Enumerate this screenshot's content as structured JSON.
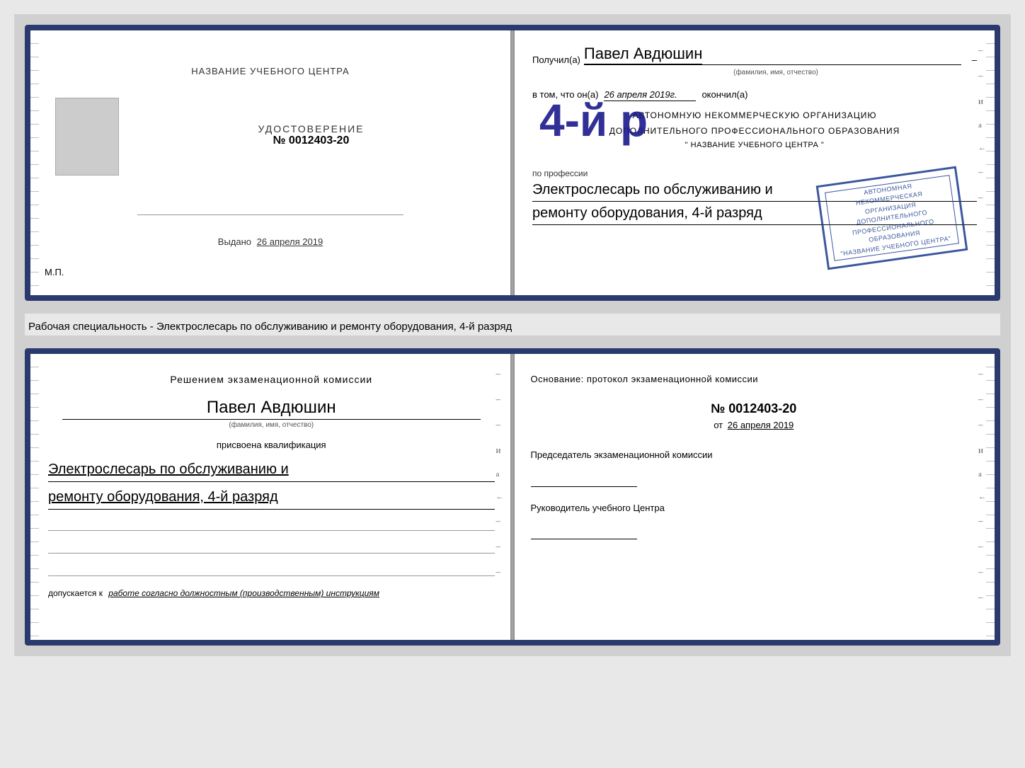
{
  "page": {
    "background": "#d0d0d0"
  },
  "top_doc": {
    "left": {
      "title": "НАЗВАНИЕ УЧЕБНОГО ЦЕНТРА",
      "cert_label": "УДОСТОВЕРЕНИЕ",
      "cert_number": "№ 0012403-20",
      "issued_label": "Выдано",
      "issued_date": "26 апреля 2019",
      "mp_label": "М.П."
    },
    "right": {
      "recipient_prefix": "Получил(а)",
      "recipient_name": "Павел Авдюшин",
      "fio_label": "(фамилия, имя, отчество)",
      "vtom_prefix": "в том, что он(а)",
      "vtom_date": "26 апреля 2019г.",
      "okonchil": "окончил(а)",
      "rank_badge": "4-й р",
      "org_line1": "АВТОНОМНУЮ НЕКОММЕРЧЕСКУЮ ОРГАНИЗАЦИЮ",
      "org_line2": "ДОПОЛНИТЕЛЬНОГО ПРОФЕССИОНАЛЬНОГО ОБРАЗОВАНИЯ",
      "org_name": "\" НАЗВАНИЕ УЧЕБНОГО ЦЕНТРА \"",
      "profession_prefix": "по профессии",
      "profession_line1": "Электрослесарь по обслуживанию и",
      "profession_line2": "ремонту оборудования, 4-й разряд",
      "stamp_line1": "АВТОНОМНАЯ НЕКОММЕРЧЕСКАЯ",
      "stamp_line2": "ОРГАНИЗАЦИЯ",
      "stamp_line3": "ДОПОЛНИТЕЛЬНОГО",
      "stamp_line4": "ПРОФЕССИОНАЛЬНОГО",
      "stamp_line5": "ОБРАЗОВАНИЯ",
      "stamp_line6": "\"НАЗВАНИЕ УЧЕБНОГО ЦЕНТРА\""
    }
  },
  "specialty_label": "Рабочая специальность - Электрослесарь по обслуживанию и ремонту оборудования, 4-й разряд",
  "bottom_doc": {
    "left": {
      "commission_title": "Решением экзаменационной комиссии",
      "person_name": "Павел Авдюшин",
      "fio_label": "(фамилия, имя, отчество)",
      "qualification_prefix": "присвоена квалификация",
      "qualification_line1": "Электрослесарь по обслуживанию и",
      "qualification_line2": "ремонту оборудования, 4-й разряд",
      "допускается_text": "допускается к",
      "допускается_italic": "работе согласно должностным (производственным) инструкциям"
    },
    "right": {
      "osnovaniye_label": "Основание: протокол экзаменационной комиссии",
      "protocol_number": "№ 0012403-20",
      "ot_prefix": "от",
      "ot_date": "26 апреля 2019",
      "chairman_title": "Председатель экзаменационной комиссии",
      "director_title": "Руководитель учебного Центра"
    }
  },
  "side_dashes": [
    "-",
    "-",
    "-",
    "и",
    "а",
    "←",
    "-",
    "-",
    "-",
    "-",
    "-"
  ],
  "side_dashes_bottom": [
    "-",
    "-",
    "-",
    "и",
    "а",
    "←",
    "-",
    "-",
    "-",
    "-",
    "-"
  ]
}
